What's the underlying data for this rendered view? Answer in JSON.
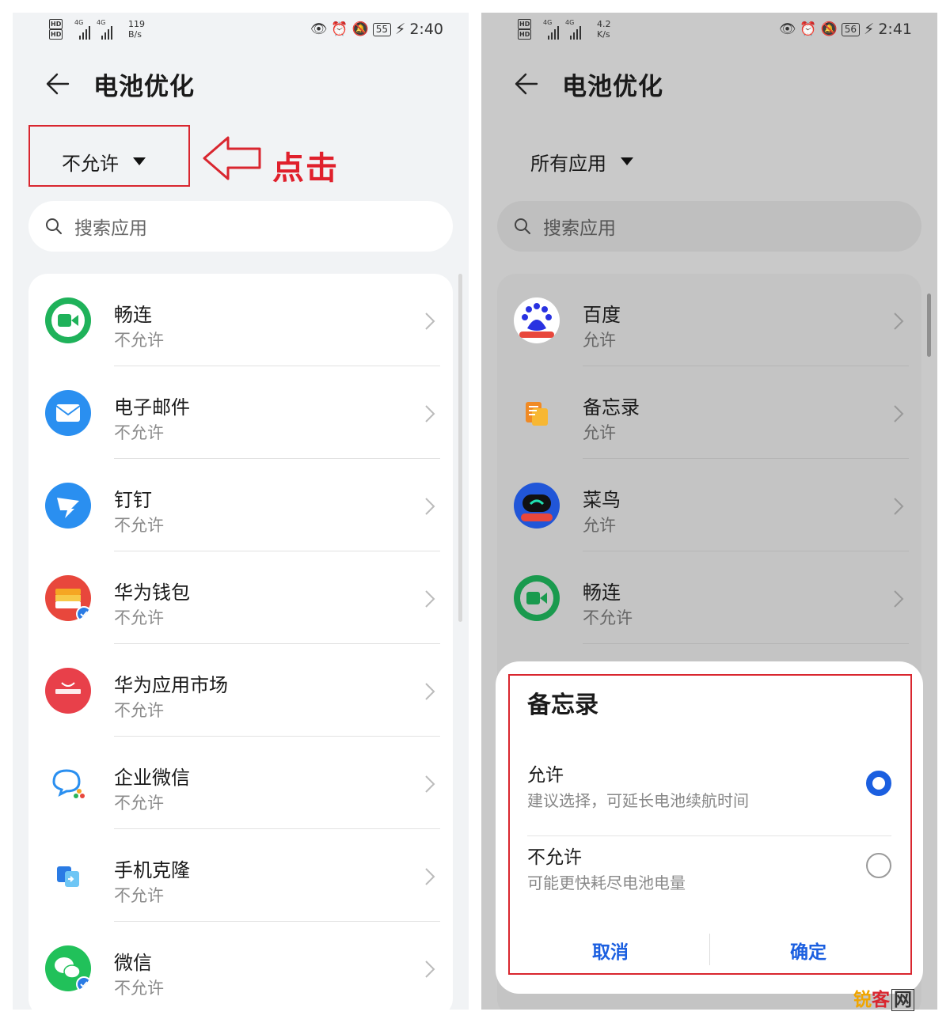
{
  "left": {
    "status_bar": {
      "hd1": "HD",
      "hd2": "HD",
      "net1": "4G",
      "net2": "4G",
      "speed_value": "119",
      "speed_unit": "B/s",
      "battery": "55",
      "time": "2:40"
    },
    "header": {
      "title": "电池优化"
    },
    "filter": {
      "label": "不允许"
    },
    "annotation": {
      "label": "点击"
    },
    "search": {
      "placeholder": "搜索应用"
    },
    "apps": [
      {
        "name": "畅连",
        "status": "不允许",
        "icon": "changlian-icon"
      },
      {
        "name": "电子邮件",
        "status": "不允许",
        "icon": "email-icon"
      },
      {
        "name": "钉钉",
        "status": "不允许",
        "icon": "dingtalk-icon"
      },
      {
        "name": "华为钱包",
        "status": "不允许",
        "icon": "huawei-wallet-icon"
      },
      {
        "name": "华为应用市场",
        "status": "不允许",
        "icon": "huawei-appgallery-icon"
      },
      {
        "name": "企业微信",
        "status": "不允许",
        "icon": "wecom-icon"
      },
      {
        "name": "手机克隆",
        "status": "不允许",
        "icon": "phone-clone-icon"
      },
      {
        "name": "微信",
        "status": "不允许",
        "icon": "wechat-icon"
      }
    ]
  },
  "right": {
    "status_bar": {
      "hd1": "HD",
      "hd2": "HD",
      "net1": "4G",
      "net2": "4G",
      "speed_value": "4.2",
      "speed_unit": "K/s",
      "battery": "56",
      "time": "2:41"
    },
    "header": {
      "title": "电池优化"
    },
    "filter": {
      "label": "所有应用"
    },
    "search": {
      "placeholder": "搜索应用"
    },
    "apps": [
      {
        "name": "百度",
        "status": "允许",
        "icon": "baidu-icon"
      },
      {
        "name": "备忘录",
        "status": "允许",
        "icon": "notes-icon"
      },
      {
        "name": "菜鸟",
        "status": "允许",
        "icon": "cainiao-icon"
      },
      {
        "name": "畅连",
        "status": "不允许",
        "icon": "changlian-icon"
      }
    ],
    "dialog": {
      "title": "备忘录",
      "options": [
        {
          "title": "允许",
          "desc": "建议选择，可延长电池续航时间",
          "selected": true
        },
        {
          "title": "不允许",
          "desc": "可能更快耗尽电池电量",
          "selected": false
        }
      ],
      "cancel": "取消",
      "confirm": "确定"
    }
  },
  "watermark": {
    "part1": "锐",
    "part2": "客",
    "part3": "网"
  },
  "colors": {
    "accent": "#1b5fe0",
    "annotation": "#d9262f"
  }
}
